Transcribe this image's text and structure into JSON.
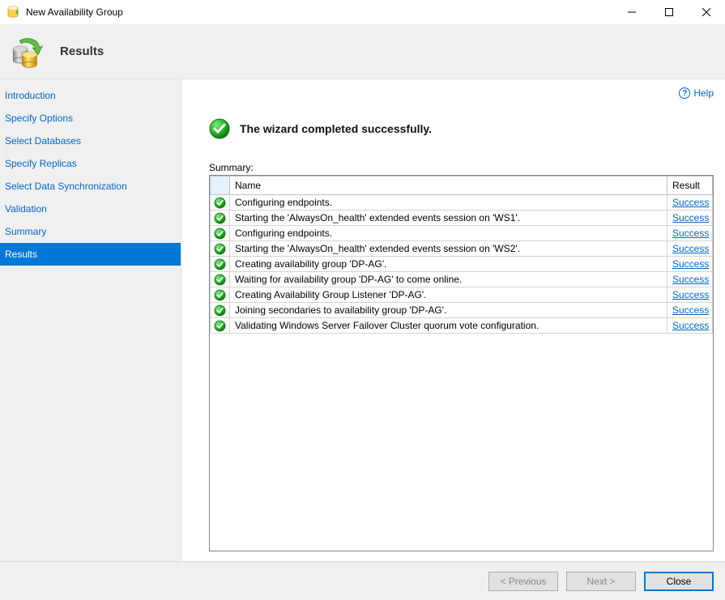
{
  "window": {
    "title": "New Availability Group",
    "minimize": "—",
    "maximize": "☐",
    "close": "✕"
  },
  "header": {
    "title": "Results"
  },
  "sidebar": {
    "items": [
      {
        "label": "Introduction",
        "active": false
      },
      {
        "label": "Specify Options",
        "active": false
      },
      {
        "label": "Select Databases",
        "active": false
      },
      {
        "label": "Specify Replicas",
        "active": false
      },
      {
        "label": "Select Data Synchronization",
        "active": false
      },
      {
        "label": "Validation",
        "active": false
      },
      {
        "label": "Summary",
        "active": false
      },
      {
        "label": "Results",
        "active": true
      }
    ]
  },
  "main": {
    "help_label": "Help",
    "heading": "The wizard completed successfully.",
    "summary_label": "Summary:",
    "columns": {
      "name": "Name",
      "result": "Result"
    },
    "rows": [
      {
        "name": "Configuring endpoints.",
        "result": "Success"
      },
      {
        "name": "Starting the 'AlwaysOn_health' extended events session on 'WS1'.",
        "result": "Success"
      },
      {
        "name": "Configuring endpoints.",
        "result": "Success"
      },
      {
        "name": "Starting the 'AlwaysOn_health' extended events session on 'WS2'.",
        "result": "Success"
      },
      {
        "name": "Creating availability group 'DP-AG'.",
        "result": "Success"
      },
      {
        "name": "Waiting for availability group 'DP-AG' to come online.",
        "result": "Success"
      },
      {
        "name": "Creating Availability Group Listener 'DP-AG'.",
        "result": "Success"
      },
      {
        "name": "Joining secondaries to availability group 'DP-AG'.",
        "result": "Success"
      },
      {
        "name": "Validating Windows Server Failover Cluster quorum vote configuration.",
        "result": "Success"
      }
    ]
  },
  "footer": {
    "previous": "< Previous",
    "next": "Next >",
    "close": "Close"
  }
}
